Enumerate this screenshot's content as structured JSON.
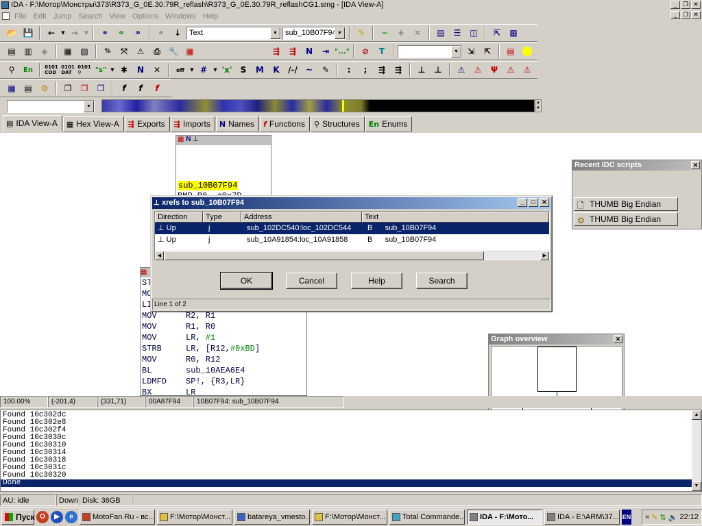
{
  "window": {
    "title": "IDA - F:\\Мотор\\Монстры\\373\\R373_G_0E.30.79R_reflash\\R373_G_0E.30.79R_reflashCG1.smg - [IDA View-A]"
  },
  "menu": [
    "File",
    "Edit",
    "Jump",
    "Search",
    "View",
    "Options",
    "Windows",
    "Help"
  ],
  "toolbar": {
    "type_combo": "Text",
    "func_combo": "sub_10B07F94"
  },
  "tabs": [
    {
      "label": "IDA View-A",
      "icon": "disasm-icon"
    },
    {
      "label": "Hex View-A",
      "icon": "hex-icon"
    },
    {
      "label": "Exports",
      "icon": "exports-icon"
    },
    {
      "label": "Imports",
      "icon": "imports-icon"
    },
    {
      "label": "Names",
      "icon": "N"
    },
    {
      "label": "Functions",
      "icon": "f"
    },
    {
      "label": "Structures",
      "icon": "structures-icon"
    },
    {
      "label": "Enums",
      "icon": "En"
    }
  ],
  "graph": {
    "node1": {
      "label": "sub_10B07F94",
      "partial_line": "BMP    R0, #0x7D"
    },
    "node2": {
      "partial_rows": [
        "ST",
        "MO",
        "LI"
      ],
      "rows": [
        {
          "op": "MOV",
          "args": "R2, R1"
        },
        {
          "op": "MOV",
          "args": "R1, R0"
        },
        {
          "op": "MOV",
          "args": "LR, ",
          "num": "#1"
        },
        {
          "op": "STRB",
          "args": "LR, [R12,",
          "num": "#0xBD",
          "tail": "]"
        },
        {
          "op": "MOV",
          "args": "R0, R12"
        },
        {
          "op": "BL",
          "args": "sub_10AEA6E4"
        },
        {
          "op": "LDMFD",
          "args": "SP!, {R3,LR}"
        },
        {
          "op": "BX",
          "args": "LR"
        }
      ]
    }
  },
  "xrefs_dialog": {
    "title": "xrefs to sub_10B07F94",
    "columns": [
      "Direction",
      "Type",
      "Address",
      "Text"
    ],
    "rows": [
      {
        "direction": "Up",
        "type": "j",
        "address": "sub_102DC540:loc_102DC544",
        "text": "B      sub_10B07F94"
      },
      {
        "direction": "Up",
        "type": "j",
        "address": "sub_10A91854:loc_10A91858",
        "text": "B      sub_10B07F94"
      }
    ],
    "buttons": {
      "ok": "OK",
      "cancel": "Cancel",
      "help": "Help",
      "search": "Search"
    },
    "status": "Line 1 of 2"
  },
  "idc_panel": {
    "title": "Recent IDC scripts",
    "items": [
      "THUMB Big Endian",
      "THUMB Big Endian"
    ]
  },
  "graph_overview": {
    "title": "Graph overview"
  },
  "posbar": {
    "zoom": "100.00%",
    "coords1": "(-201,4)",
    "coords2": "(331,71)",
    "offset": "00A87F94",
    "location": "10B07F94: sub_10B07F94"
  },
  "output": {
    "lines": [
      "Found 10c302dc",
      "Found 10c302e8",
      "Found 10c302f4",
      "Found 10c3030c",
      "Found 10c30310",
      "Found 10c30314",
      "Found 10c30318",
      "Found 10c3031c",
      "Found 10c30320"
    ],
    "last": "Done"
  },
  "statusbar": {
    "au": "AU:  idle",
    "direction": "Down",
    "disk": "Disk: 36GB"
  },
  "taskbar": {
    "start": "Пуск",
    "tasks": [
      {
        "label": "MotoFan.Ru - вс..."
      },
      {
        "label": "F:\\Мотор\\Монст..."
      },
      {
        "label": "batareya_vmesto..."
      },
      {
        "label": "F:\\Мотор\\Монст..."
      },
      {
        "label": "Total Commande..."
      },
      {
        "label": "IDA - F:\\Мото...",
        "active": true
      },
      {
        "label": "IDA - E:\\ARM\\37..."
      }
    ],
    "lang": "EN",
    "clock": "22:12"
  }
}
